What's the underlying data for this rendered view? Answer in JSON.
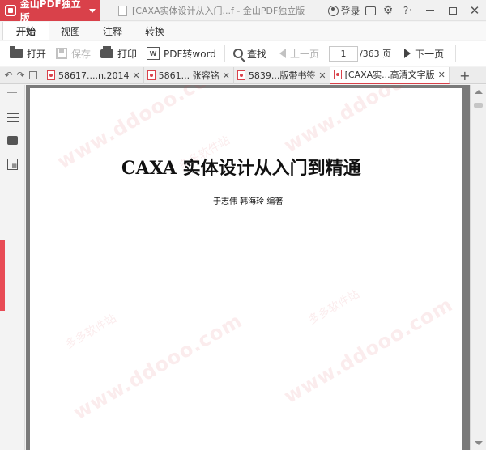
{
  "app": {
    "name": "金山PDF独立版",
    "window_title": "[CAXA实体设计从入门...f - 金山PDF独立版"
  },
  "window_controls": {
    "login_label": "登录",
    "help_label": "?",
    "help_caret": "·"
  },
  "menu_tabs": [
    {
      "label": "开始",
      "active": true
    },
    {
      "label": "视图"
    },
    {
      "label": "注释"
    },
    {
      "label": "转换"
    }
  ],
  "toolbar": {
    "open": "打开",
    "save": "保存",
    "print": "打印",
    "pdf_to_word": "PDF转word",
    "find": "查找",
    "prev_page": "上一页",
    "current_page": "1",
    "total_pages": "/363 页",
    "next_page": "下一页"
  },
  "doc_tabs": [
    {
      "label": "58617....n.2014"
    },
    {
      "label": "5861... 张容铭"
    },
    {
      "label": "5839...版带书签"
    },
    {
      "label": "[CAXA实...高清文字版",
      "active": true
    }
  ],
  "document": {
    "title": "CAXA 实体设计从入门到精通",
    "authors": "于志伟    韩海玲  编著",
    "watermark_url": "www.ddooo.com",
    "watermark_cn": "多多软件站"
  },
  "colors": {
    "accent": "#d9414a",
    "viewer_bg": "#7a7a7a"
  }
}
